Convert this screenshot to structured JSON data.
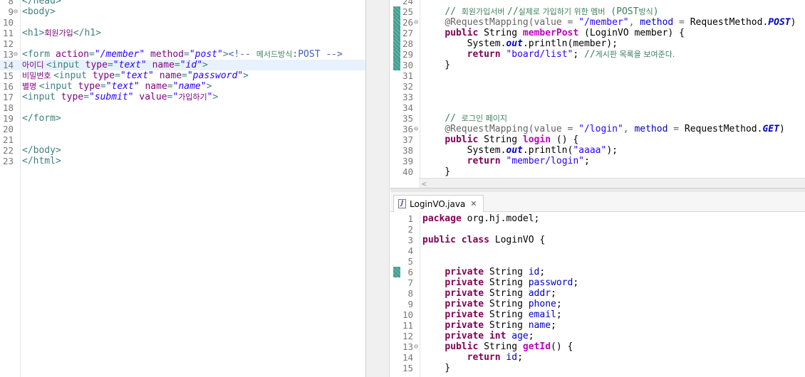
{
  "left_editor": {
    "lines": [
      {
        "n": "8",
        "fold": false,
        "marker": false,
        "current": false,
        "segs": [
          [
            "tag",
            "</head>"
          ]
        ]
      },
      {
        "n": "9",
        "fold": true,
        "marker": false,
        "current": false,
        "segs": [
          [
            "tag",
            "<body>"
          ]
        ]
      },
      {
        "n": "10",
        "fold": false,
        "marker": false,
        "current": false,
        "segs": []
      },
      {
        "n": "11",
        "fold": false,
        "marker": false,
        "current": false,
        "segs": [
          [
            "tag",
            "<h1>"
          ],
          [
            "kor",
            "회원가입"
          ],
          [
            "tag",
            "</h1>"
          ]
        ]
      },
      {
        "n": "12",
        "fold": false,
        "marker": false,
        "current": false,
        "segs": []
      },
      {
        "n": "13",
        "fold": true,
        "marker": false,
        "current": false,
        "segs": [
          [
            "tag",
            "<form "
          ],
          [
            "attr",
            "action"
          ],
          [
            "tag",
            "="
          ],
          [
            "val",
            "\"/member\""
          ],
          [
            "tag",
            " "
          ],
          [
            "attr",
            "method"
          ],
          [
            "tag",
            "="
          ],
          [
            "val",
            "\"post\""
          ],
          [
            "tag",
            ">"
          ],
          [
            "cmt",
            "<!-- "
          ],
          [
            "cmtk",
            "메서드방식"
          ],
          [
            "cmt",
            ":POST -->"
          ]
        ]
      },
      {
        "n": "14",
        "fold": false,
        "marker": true,
        "current": true,
        "segs": [
          [
            "kor",
            "아이디 "
          ],
          [
            "tag",
            "<input "
          ],
          [
            "attr",
            "type"
          ],
          [
            "tag",
            "="
          ],
          [
            "val",
            "\"text\""
          ],
          [
            "tag",
            " "
          ],
          [
            "attr",
            "name"
          ],
          [
            "tag",
            "="
          ],
          [
            "val",
            "\"id\""
          ],
          [
            "tag",
            ">"
          ]
        ]
      },
      {
        "n": "15",
        "fold": false,
        "marker": false,
        "current": false,
        "segs": [
          [
            "kor",
            "비밀번호 "
          ],
          [
            "tag",
            "<input "
          ],
          [
            "attr",
            "type"
          ],
          [
            "tag",
            "="
          ],
          [
            "val",
            "\"text\""
          ],
          [
            "tag",
            " "
          ],
          [
            "attr",
            "name"
          ],
          [
            "tag",
            "="
          ],
          [
            "val",
            "\"password\""
          ],
          [
            "tag",
            ">"
          ]
        ]
      },
      {
        "n": "16",
        "fold": false,
        "marker": false,
        "current": false,
        "segs": [
          [
            "kor",
            "별명 "
          ],
          [
            "tag",
            "<input "
          ],
          [
            "attr",
            "type"
          ],
          [
            "tag",
            "="
          ],
          [
            "val",
            "\"text\""
          ],
          [
            "tag",
            " "
          ],
          [
            "attr",
            "name"
          ],
          [
            "tag",
            "="
          ],
          [
            "val",
            "\"name\""
          ],
          [
            "tag",
            ">"
          ]
        ]
      },
      {
        "n": "17",
        "fold": false,
        "marker": false,
        "current": false,
        "segs": [
          [
            "tag",
            "<input "
          ],
          [
            "attr",
            "type"
          ],
          [
            "tag",
            "="
          ],
          [
            "val",
            "\"submit\""
          ],
          [
            "tag",
            " "
          ],
          [
            "attr",
            "value"
          ],
          [
            "tag",
            "="
          ],
          [
            "val",
            "\""
          ],
          [
            "korv",
            "가입하기"
          ],
          [
            "val",
            "\""
          ],
          [
            "tag",
            ">"
          ]
        ]
      },
      {
        "n": "18",
        "fold": false,
        "marker": false,
        "current": false,
        "segs": []
      },
      {
        "n": "19",
        "fold": false,
        "marker": false,
        "current": false,
        "segs": [
          [
            "tag",
            "</form>"
          ]
        ]
      },
      {
        "n": "20",
        "fold": false,
        "marker": false,
        "current": false,
        "segs": []
      },
      {
        "n": "21",
        "fold": false,
        "marker": false,
        "current": false,
        "segs": []
      },
      {
        "n": "22",
        "fold": false,
        "marker": false,
        "current": false,
        "segs": [
          [
            "tag",
            "</body>"
          ]
        ]
      },
      {
        "n": "23",
        "fold": false,
        "marker": false,
        "current": false,
        "segs": [
          [
            "tag",
            "</html>"
          ]
        ]
      }
    ]
  },
  "right_top_editor": {
    "lines": [
      {
        "n": "24",
        "fold": false,
        "marker": false,
        "segs": []
      },
      {
        "n": "25",
        "fold": false,
        "marker": true,
        "segs": [
          [
            "plain",
            "    "
          ],
          [
            "cmtj",
            "// "
          ],
          [
            "korc",
            "회원가입서버 "
          ],
          [
            "cmtj",
            "//"
          ],
          [
            "korc",
            "실제로 가입하기 위한 멤버"
          ],
          [
            "cmtj",
            " (POST"
          ],
          [
            "korc",
            "방식"
          ],
          [
            "cmtj",
            ")"
          ]
        ]
      },
      {
        "n": "26",
        "fold": true,
        "marker": true,
        "segs": [
          [
            "plain",
            "    "
          ],
          [
            "anno",
            "@RequestMapping(value = "
          ],
          [
            "str",
            "\"/member\""
          ],
          [
            "anno",
            ", "
          ],
          [
            "fldn",
            "method"
          ],
          [
            "anno",
            " = "
          ],
          [
            "plain",
            "RequestMethod."
          ],
          [
            "fld",
            "POST"
          ],
          [
            "plain",
            ")"
          ]
        ]
      },
      {
        "n": "27",
        "fold": false,
        "marker": true,
        "segs": [
          [
            "plain",
            "    "
          ],
          [
            "kw",
            "public"
          ],
          [
            "plain",
            " String "
          ],
          [
            "meth",
            "memberPost"
          ],
          [
            "plain",
            " (LoginVO member) {"
          ]
        ]
      },
      {
        "n": "28",
        "fold": false,
        "marker": true,
        "segs": [
          [
            "plain",
            "        System."
          ],
          [
            "fld",
            "out"
          ],
          [
            "plain",
            ".println(member);"
          ]
        ]
      },
      {
        "n": "29",
        "fold": false,
        "marker": true,
        "segs": [
          [
            "plain",
            "        "
          ],
          [
            "kw",
            "return"
          ],
          [
            "plain",
            " "
          ],
          [
            "str",
            "\"board/list\""
          ],
          [
            "plain",
            "; "
          ],
          [
            "cmtj",
            "//"
          ],
          [
            "korc",
            "게시판 목록을 보여준다."
          ]
        ]
      },
      {
        "n": "30",
        "fold": false,
        "marker": true,
        "segs": [
          [
            "plain",
            "    }"
          ]
        ]
      },
      {
        "n": "31",
        "fold": false,
        "marker": false,
        "segs": []
      },
      {
        "n": "32",
        "fold": false,
        "marker": false,
        "segs": []
      },
      {
        "n": "33",
        "fold": false,
        "marker": false,
        "segs": []
      },
      {
        "n": "34",
        "fold": false,
        "marker": false,
        "segs": []
      },
      {
        "n": "35",
        "fold": false,
        "marker": false,
        "segs": [
          [
            "plain",
            "    "
          ],
          [
            "cmtj",
            "// "
          ],
          [
            "korc",
            "로그인 페이지"
          ]
        ]
      },
      {
        "n": "36",
        "fold": true,
        "marker": false,
        "segs": [
          [
            "plain",
            "    "
          ],
          [
            "anno",
            "@RequestMapping(value = "
          ],
          [
            "str",
            "\"/login\""
          ],
          [
            "anno",
            ", "
          ],
          [
            "fldn",
            "method"
          ],
          [
            "anno",
            " = "
          ],
          [
            "plain",
            "RequestMethod."
          ],
          [
            "fld",
            "GET"
          ],
          [
            "plain",
            ")"
          ]
        ]
      },
      {
        "n": "37",
        "fold": false,
        "marker": false,
        "segs": [
          [
            "plain",
            "    "
          ],
          [
            "kw",
            "public"
          ],
          [
            "plain",
            " String "
          ],
          [
            "meth",
            "login"
          ],
          [
            "plain",
            " () {"
          ]
        ]
      },
      {
        "n": "38",
        "fold": false,
        "marker": false,
        "segs": [
          [
            "plain",
            "        System."
          ],
          [
            "fld",
            "out"
          ],
          [
            "plain",
            ".println("
          ],
          [
            "str",
            "\"aaaa\""
          ],
          [
            "plain",
            ");"
          ]
        ]
      },
      {
        "n": "39",
        "fold": false,
        "marker": false,
        "segs": [
          [
            "plain",
            "        "
          ],
          [
            "kw",
            "return"
          ],
          [
            "plain",
            " "
          ],
          [
            "str",
            "\"member/login\""
          ],
          [
            "plain",
            ";"
          ]
        ]
      },
      {
        "n": "40",
        "fold": false,
        "marker": false,
        "segs": [
          [
            "plain",
            "    }"
          ]
        ]
      }
    ]
  },
  "right_bottom_editor": {
    "tab_label": "LoginVO.java",
    "tab_close": "✕",
    "lines": [
      {
        "n": "1",
        "fold": false,
        "marker": false,
        "segs": [
          [
            "kw",
            "package"
          ],
          [
            "plain",
            " org.hj.model;"
          ]
        ]
      },
      {
        "n": "2",
        "fold": false,
        "marker": false,
        "segs": []
      },
      {
        "n": "3",
        "fold": false,
        "marker": false,
        "segs": [
          [
            "kw",
            "public"
          ],
          [
            "plain",
            " "
          ],
          [
            "kw",
            "class"
          ],
          [
            "plain",
            " LoginVO {"
          ]
        ]
      },
      {
        "n": "4",
        "fold": false,
        "marker": false,
        "segs": []
      },
      {
        "n": "5",
        "fold": false,
        "marker": false,
        "segs": []
      },
      {
        "n": "6",
        "fold": false,
        "marker": true,
        "segs": [
          [
            "plain",
            "    "
          ],
          [
            "kw",
            "private"
          ],
          [
            "plain",
            " String "
          ],
          [
            "fldn",
            "id"
          ],
          [
            "plain",
            ";"
          ]
        ]
      },
      {
        "n": "7",
        "fold": false,
        "marker": false,
        "segs": [
          [
            "plain",
            "    "
          ],
          [
            "kw",
            "private"
          ],
          [
            "plain",
            " String "
          ],
          [
            "fldn",
            "password"
          ],
          [
            "plain",
            ";"
          ]
        ]
      },
      {
        "n": "8",
        "fold": false,
        "marker": false,
        "segs": [
          [
            "plain",
            "    "
          ],
          [
            "kw",
            "private"
          ],
          [
            "plain",
            " String "
          ],
          [
            "fldn",
            "addr"
          ],
          [
            "plain",
            ";"
          ]
        ]
      },
      {
        "n": "9",
        "fold": false,
        "marker": false,
        "segs": [
          [
            "plain",
            "    "
          ],
          [
            "kw",
            "private"
          ],
          [
            "plain",
            " String "
          ],
          [
            "fldn",
            "phone"
          ],
          [
            "plain",
            ";"
          ]
        ]
      },
      {
        "n": "10",
        "fold": false,
        "marker": false,
        "segs": [
          [
            "plain",
            "    "
          ],
          [
            "kw",
            "private"
          ],
          [
            "plain",
            " String "
          ],
          [
            "fldn",
            "email"
          ],
          [
            "plain",
            ";"
          ]
        ]
      },
      {
        "n": "11",
        "fold": false,
        "marker": false,
        "segs": [
          [
            "plain",
            "    "
          ],
          [
            "kw",
            "private"
          ],
          [
            "plain",
            " String "
          ],
          [
            "fldn",
            "name"
          ],
          [
            "plain",
            ";"
          ]
        ]
      },
      {
        "n": "12",
        "fold": false,
        "marker": false,
        "segs": [
          [
            "plain",
            "    "
          ],
          [
            "kw",
            "private"
          ],
          [
            "plain",
            " "
          ],
          [
            "kw",
            "int"
          ],
          [
            "plain",
            " "
          ],
          [
            "fldn",
            "age"
          ],
          [
            "plain",
            ";"
          ]
        ]
      },
      {
        "n": "13",
        "fold": true,
        "marker": false,
        "segs": [
          [
            "plain",
            "    "
          ],
          [
            "kw",
            "public"
          ],
          [
            "plain",
            " String "
          ],
          [
            "meth",
            "getId"
          ],
          [
            "plain",
            "() {"
          ]
        ]
      },
      {
        "n": "14",
        "fold": false,
        "marker": false,
        "segs": [
          [
            "plain",
            "        "
          ],
          [
            "kw",
            "return"
          ],
          [
            "plain",
            " "
          ],
          [
            "fldn",
            "id"
          ],
          [
            "plain",
            ";"
          ]
        ]
      },
      {
        "n": "15",
        "fold": false,
        "marker": false,
        "segs": [
          [
            "plain",
            "    }"
          ]
        ]
      }
    ]
  }
}
